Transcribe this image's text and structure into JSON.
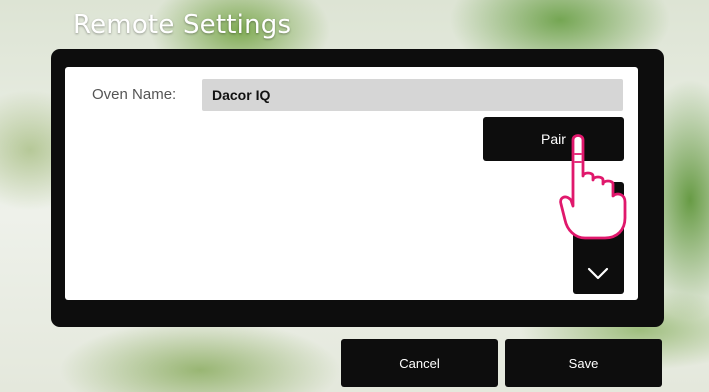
{
  "title": "Remote Settings",
  "form": {
    "oven_name_label": "Oven Name:",
    "oven_name_value": "Dacor IQ"
  },
  "buttons": {
    "pair": "Pair",
    "cancel": "Cancel",
    "save": "Save"
  },
  "icons": {
    "scroll_down": "chevron-down-icon",
    "pointer": "hand-pointer-icon"
  },
  "colors": {
    "panel": "#0d0d0d",
    "input_bg": "#d6d6d6",
    "hand_stroke": "#e0186c"
  }
}
